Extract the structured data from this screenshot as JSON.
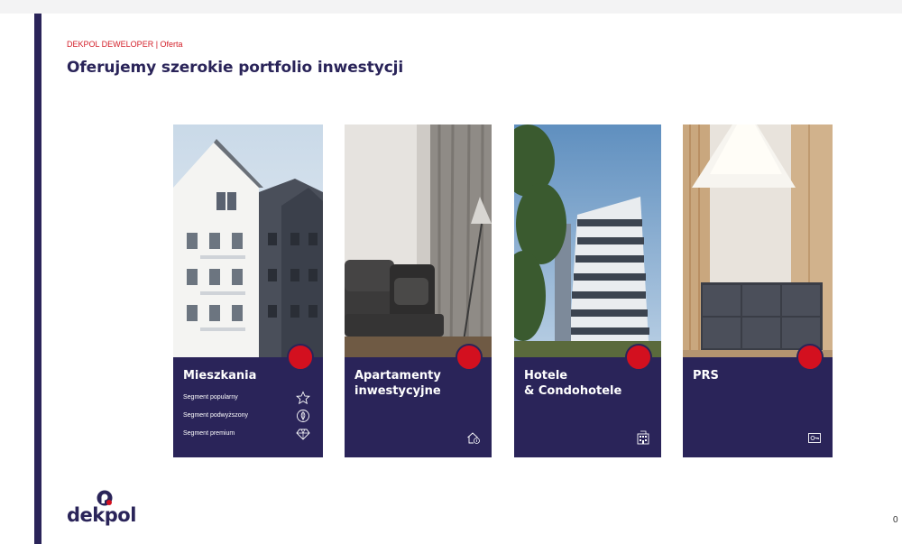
{
  "header": {
    "breadcrumb": "DEKPOL DEWELOPER | Oferta",
    "title": "Oferujemy szerokie portfolio inwestycji"
  },
  "cards": [
    {
      "title": "Mieszkania",
      "segments": [
        {
          "label": "Segment popularny",
          "icon": "star-icon"
        },
        {
          "label": "Segment podwyższony",
          "icon": "leaf-badge-icon"
        },
        {
          "label": "Segment premium",
          "icon": "diamond-icon"
        }
      ]
    },
    {
      "title": "Apartamenty\ninwestycyjne",
      "icon": "house-coin-icon"
    },
    {
      "title": "Hotele\n& Condohotele",
      "icon": "hotel-building-icon"
    },
    {
      "title": "PRS",
      "icon": "key-card-icon"
    }
  ],
  "logo": {
    "text": "dekpol"
  },
  "page_number": "0",
  "colors": {
    "navy": "#2a2459",
    "red": "#d3101f"
  }
}
